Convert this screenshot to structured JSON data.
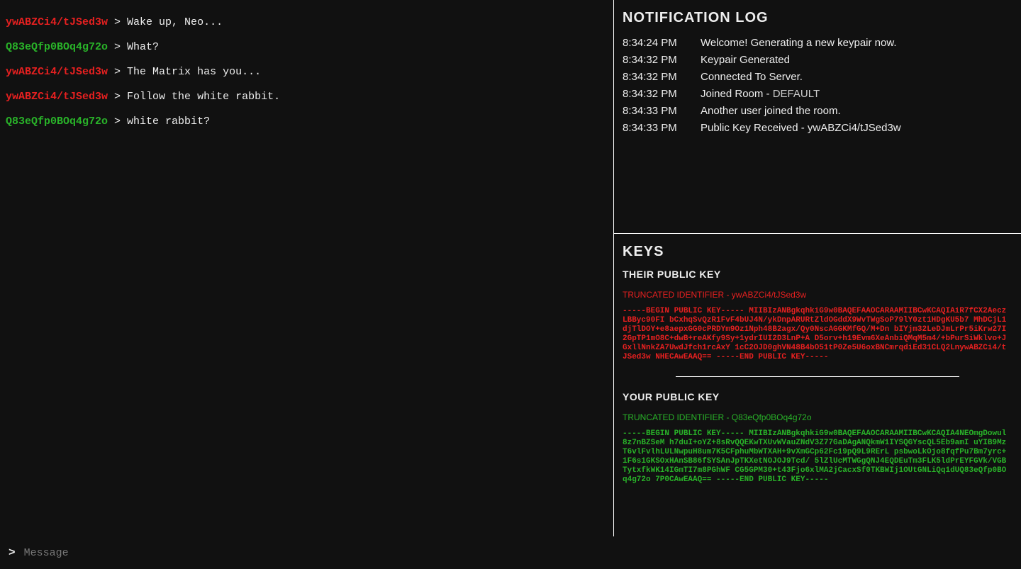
{
  "chat": {
    "messages": [
      {
        "user": "ywABZCi4/tJSed3w",
        "color": "red",
        "text": "Wake up, Neo..."
      },
      {
        "user": "Q83eQfp0BOq4g72o",
        "color": "green",
        "text": "What?"
      },
      {
        "user": "ywABZCi4/tJSed3w",
        "color": "red",
        "text": "The Matrix has you..."
      },
      {
        "user": "ywABZCi4/tJSed3w",
        "color": "red",
        "text": "Follow the white rabbit."
      },
      {
        "user": "Q83eQfp0BOq4g72o",
        "color": "green",
        "text": "white rabbit?"
      }
    ]
  },
  "notification_log": {
    "title": "NOTIFICATION LOG",
    "entries": [
      {
        "time": "8:34:24 PM",
        "msg": "Welcome! Generating a new keypair now.",
        "suffix": ""
      },
      {
        "time": "8:34:32 PM",
        "msg": "Keypair Generated",
        "suffix": ""
      },
      {
        "time": "8:34:32 PM",
        "msg": "Connected To Server.",
        "suffix": ""
      },
      {
        "time": "8:34:32 PM",
        "msg": "Joined Room - ",
        "suffix": "DEFAULT"
      },
      {
        "time": "8:34:33 PM",
        "msg": "Another user joined the room.",
        "suffix": ""
      },
      {
        "time": "8:34:33 PM",
        "msg": "Public Key Received - ywABZCi4/tJSed3w",
        "suffix": ""
      }
    ]
  },
  "keys": {
    "title": "KEYS",
    "their": {
      "label": "THEIR PUBLIC KEY",
      "id_label": "TRUNCATED IDENTIFIER - ywABZCi4/tJSed3w",
      "body": "-----BEGIN PUBLIC KEY-----  MIIBIzANBgkqhkiG9w0BAQEFAAOCARAAMIIBCwKCAQIAiR7fCX2AeczLBByc90FI bCxhqSvQzR1FvF4bUJ4N/ykDnpARURtZldOGddX9WvTWgSoP79lY0zt1HDgKU5b7 MhDCjL1djTlDOY+e8aepxGG0cPRDYm9Oz1Nph48B2agx/Qy0NscAGGKMfGQ/M+Dn bIYjm32LeDJmLrPr5iKrw27I2GpTP1mO8C+dwB+reAKfy9Sy+1ydrIUI2D3LnP+A D5orv+h19Evm6XeAnbiQMqM5m4/+bPurSiWklvo+JGxllNnkZA7UwdJfch1rcAxY 1cC2OJD0ghVN48B4bO51tP0Ze5U6oxBNCmrqdiEd31CLQ2LnywABZCi4/tJSed3w NHECAwEAAQ== -----END PUBLIC KEY-----"
    },
    "your": {
      "label": "YOUR PUBLIC KEY",
      "id_label": "TRUNCATED IDENTIFIER - Q83eQfp0BOq4g72o",
      "body": "-----BEGIN PUBLIC KEY-----  MIIBIzANBgkqhkiG9w0BAQEFAAOCARAAMIIBCwKCAQIA4NEOmgDowul8z7nBZSeM h7duI+oYZ+8sRvQQEKwTXUvWVauZNdV3Z77GaDAgANQkmW1IYSQGYscQL5Eb9amI uYIB9MzT6vlFvlhLULNwpuH8um7K5CFphuMbWTXAH+9vXmGCp62Fc19pQ9L9RErL psbwoLkOjo8fqfPu7Bm7yrc+1F6s1GKSOxHAnSB86fSYSAnJpTKXetNOJOJ9Tcd/ 5lZlUcMTWGgQNJ4EQDEuTm3FLK5ldPrEYFGVk/VGBTytxfkWK14IGmTI7m8PGhWF CG5GPM30+t43Fjo6xlMA2jCacxSf0TKBWIj1OUtGNLiQq1dUQ83eQfp0BOq4g72o 7P0CAwEAAQ== -----END PUBLIC KEY-----"
    }
  },
  "input": {
    "prompt": ">",
    "placeholder": "Message",
    "value": ""
  }
}
